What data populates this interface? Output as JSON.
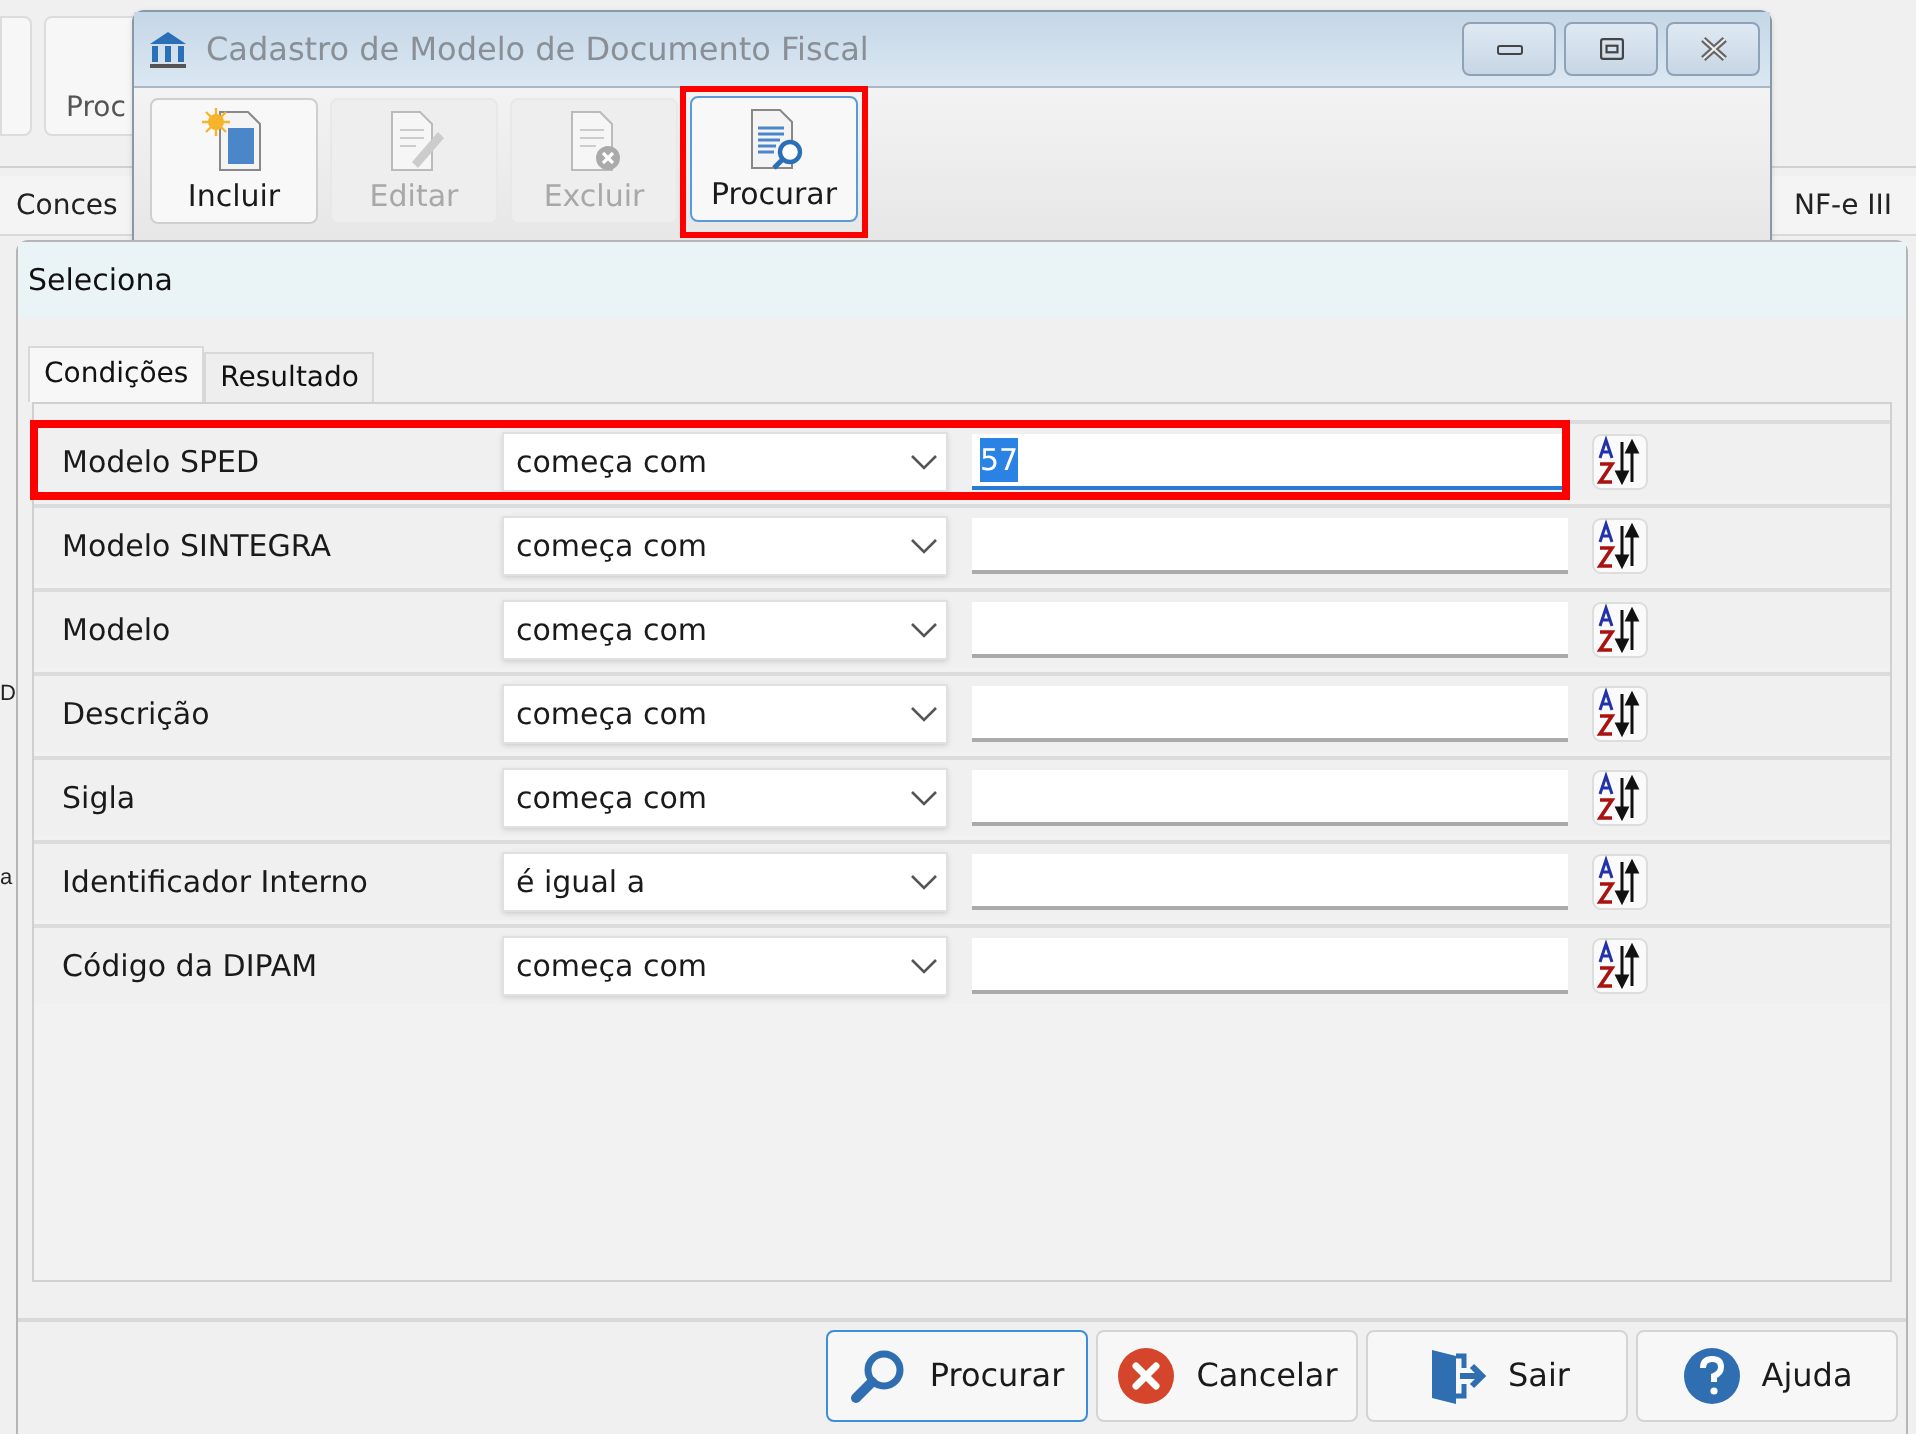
{
  "background_app": {
    "toolbar_button": "Proc",
    "tab_left": "Conces",
    "tab_right": "NF-e III",
    "edge_letters": [
      "D",
      "a"
    ]
  },
  "window": {
    "title": "Cadastro de Modelo de Documento Fiscal",
    "toolbar": [
      {
        "kind": "new",
        "label": "Incluir",
        "disabled": false,
        "highlight": false
      },
      {
        "kind": "edit",
        "label": "Editar",
        "disabled": true,
        "highlight": false
      },
      {
        "kind": "delete",
        "label": "Excluir",
        "disabled": true,
        "highlight": false
      },
      {
        "kind": "search",
        "label": "Procurar",
        "disabled": false,
        "highlight": true
      }
    ]
  },
  "dialog": {
    "title": "Seleciona",
    "tabs": [
      {
        "label": "Condições",
        "selected": true
      },
      {
        "label": "Resultado",
        "selected": false
      }
    ],
    "conditions": [
      {
        "field": "Modelo SPED",
        "operator": "começa com",
        "value": "57",
        "value_selected": true,
        "highlight": true
      },
      {
        "field": "Modelo SINTEGRA",
        "operator": "começa com",
        "highlight": false
      },
      {
        "field": "Modelo",
        "operator": "começa com",
        "highlight": false
      },
      {
        "field": "Descrição",
        "operator": "começa com",
        "highlight": false
      },
      {
        "field": "Sigla",
        "operator": "começa com",
        "highlight": false
      },
      {
        "field": "Identificador Interno",
        "operator": "é igual a",
        "highlight": false
      },
      {
        "field": "Código da DIPAM",
        "operator": "começa com",
        "highlight": false
      }
    ],
    "buttons": [
      {
        "kind": "search",
        "label": "Procurar",
        "selected": true
      },
      {
        "kind": "cancel",
        "label": "Cancelar",
        "selected": false
      },
      {
        "kind": "exit",
        "label": "Sair",
        "selected": false
      },
      {
        "kind": "help",
        "label": "Ajuda",
        "selected": false
      }
    ]
  }
}
